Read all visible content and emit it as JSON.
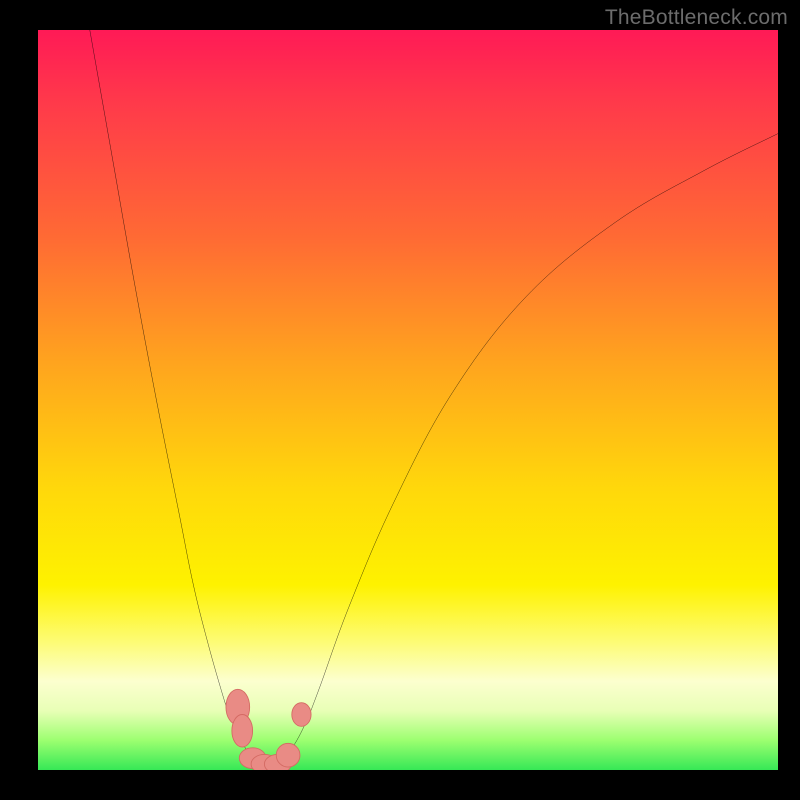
{
  "watermark": {
    "text": "TheBottleneck.com"
  },
  "colors": {
    "curve": "#000000",
    "marker_fill": "#e98b85",
    "marker_stroke": "#d46a63",
    "frame": "#000000"
  },
  "chart_data": {
    "type": "line",
    "title": "",
    "xlabel": "",
    "ylabel": "",
    "xlim": [
      0,
      100
    ],
    "ylim": [
      0,
      100
    ],
    "grid": false,
    "legend": false,
    "series": [
      {
        "name": "left-branch",
        "x": [
          7,
          10,
          13,
          16,
          19,
          21,
          23,
          25,
          26,
          27,
          28,
          29,
          30
        ],
        "y": [
          100,
          83,
          66,
          50,
          35,
          25,
          17,
          10,
          7,
          5,
          3,
          1.5,
          0.6
        ]
      },
      {
        "name": "right-branch",
        "x": [
          32,
          34,
          36,
          38,
          42,
          48,
          56,
          66,
          78,
          90,
          100
        ],
        "y": [
          0.6,
          2.5,
          6,
          11,
          22,
          36,
          51,
          64,
          74,
          81,
          86
        ]
      }
    ],
    "flat_segment": {
      "x0": 29.5,
      "x1": 32.5,
      "y": 0.5
    },
    "markers": [
      {
        "x": 27.0,
        "y": 8.5,
        "rx": 1.6,
        "ry": 2.4
      },
      {
        "x": 27.6,
        "y": 5.3,
        "rx": 1.4,
        "ry": 2.2
      },
      {
        "x": 29.0,
        "y": 1.6,
        "rx": 1.8,
        "ry": 1.4
      },
      {
        "x": 30.6,
        "y": 0.8,
        "rx": 1.8,
        "ry": 1.3
      },
      {
        "x": 32.4,
        "y": 0.8,
        "rx": 1.8,
        "ry": 1.3
      },
      {
        "x": 33.8,
        "y": 2.0,
        "rx": 1.6,
        "ry": 1.6
      },
      {
        "x": 35.6,
        "y": 7.5,
        "rx": 1.3,
        "ry": 1.6
      }
    ]
  }
}
